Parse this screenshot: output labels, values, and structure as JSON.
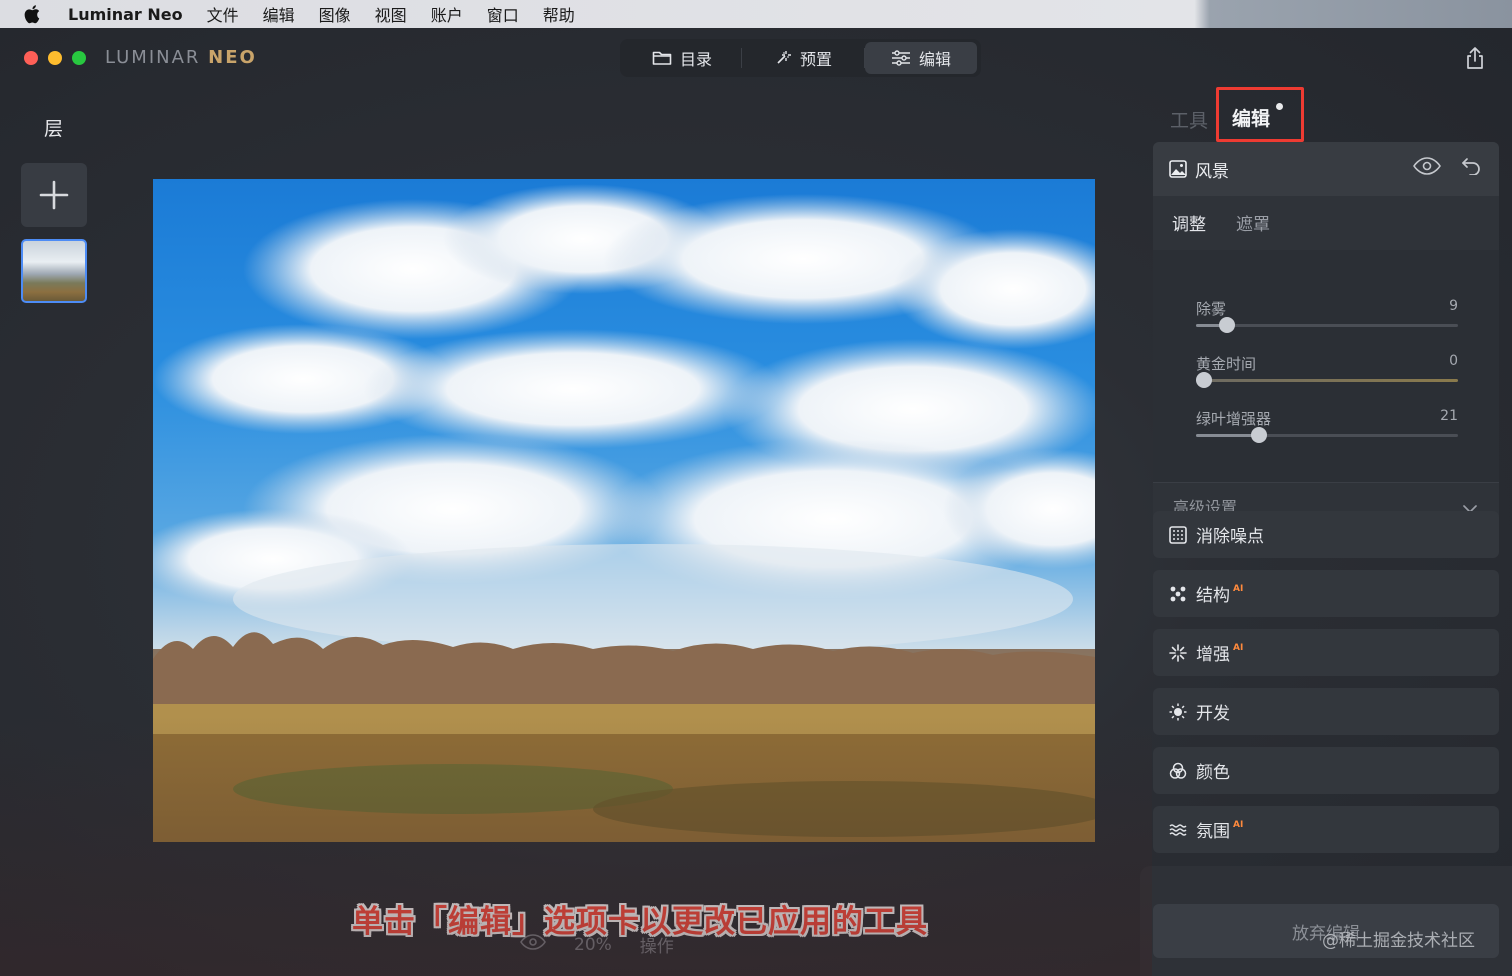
{
  "menubar": {
    "app_name": "Luminar Neo",
    "items": [
      "文件",
      "编辑",
      "图像",
      "视图",
      "账户",
      "窗口",
      "帮助"
    ]
  },
  "window": {
    "logo_part1": "LUMINAR",
    "logo_part2": "NEO"
  },
  "topnav": {
    "catalog": "目录",
    "presets": "预置",
    "edit": "编辑",
    "active": "编辑"
  },
  "layers": {
    "title": "层"
  },
  "right_panel": {
    "tab_tools": "工具",
    "tab_edit": "编辑",
    "landscape": {
      "title": "风景",
      "subtab_adjust": "调整",
      "subtab_mask": "遮罩",
      "sliders": [
        {
          "label": "除雾",
          "value": "9",
          "fraction": 0.12
        },
        {
          "label": "黄金时间",
          "value": "0",
          "fraction": 0.03
        },
        {
          "label": "绿叶增强器",
          "value": "21",
          "fraction": 0.24
        }
      ],
      "advanced": "高级设置"
    },
    "tools": [
      {
        "label": "消除噪点",
        "ai": ""
      },
      {
        "label": "结构",
        "ai": "AI"
      },
      {
        "label": "增强",
        "ai": "AI"
      },
      {
        "label": "开发",
        "ai": ""
      },
      {
        "label": "颜色",
        "ai": ""
      },
      {
        "label": "氛围",
        "ai": "AI"
      }
    ],
    "discard": "放弃编辑"
  },
  "bottom": {
    "zoom": "20%",
    "actions": "操作"
  },
  "caption": "单击「编辑」选项卡以更改已应用的工具",
  "watermark": "@稀土掘金技术社区",
  "colors": {
    "highlight_box": "#ee3b32",
    "caption_red": "#ff4a3d",
    "ai_badge": "#ff8a3d",
    "thumb_border": "#4d8cf5"
  }
}
